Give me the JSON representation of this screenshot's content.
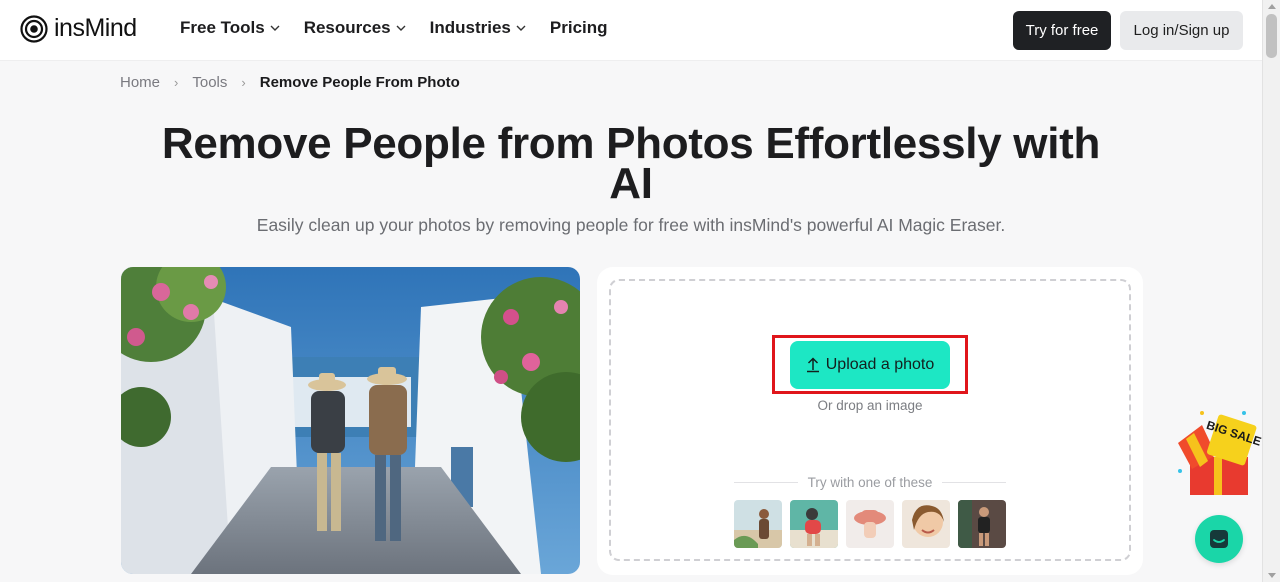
{
  "header": {
    "logo_text": "insMind",
    "nav": [
      {
        "label": "Free Tools",
        "has_dropdown": true
      },
      {
        "label": "Resources",
        "has_dropdown": true
      },
      {
        "label": "Industries",
        "has_dropdown": true
      },
      {
        "label": "Pricing",
        "has_dropdown": false
      }
    ],
    "try_label": "Try for free",
    "login_label": "Log in/Sign up"
  },
  "breadcrumb": {
    "items": [
      "Home",
      "Tools",
      "Remove People From Photo"
    ]
  },
  "hero": {
    "title": "Remove People from Photos Effortlessly with AI",
    "subtitle": "Easily clean up your photos by removing people for free with insMind's powerful AI Magic Eraser."
  },
  "upload": {
    "button_label": "Upload a photo",
    "drop_text": "Or drop an image",
    "try_text": "Try with one of these"
  },
  "promo": {
    "badge_text": "BIG SALE"
  },
  "colors": {
    "accent": "#1de7c4",
    "highlight": "#e0161b",
    "dark_button": "#1f2124",
    "chat": "#1ad6a8"
  }
}
